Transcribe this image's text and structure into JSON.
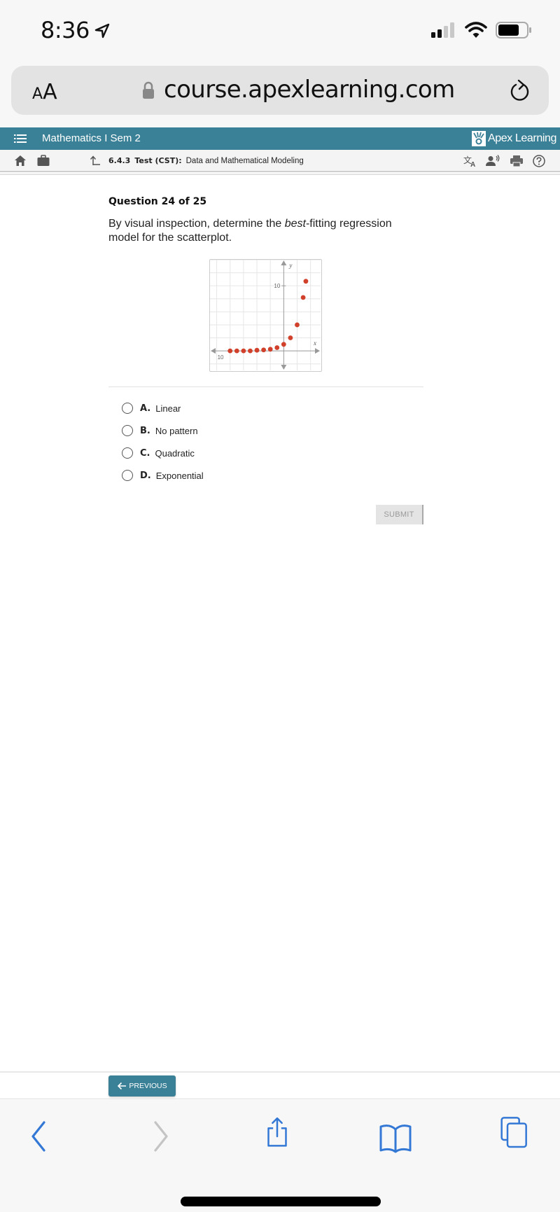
{
  "status_bar": {
    "time": "8:36",
    "icons": [
      "location-arrow-icon",
      "cellular-signal-icon",
      "wifi-icon",
      "battery-icon"
    ]
  },
  "browser": {
    "text_size_label_small": "A",
    "text_size_label_large": "A",
    "url": "course.apexlearning.com",
    "icons": [
      "lock-icon",
      "reload-icon"
    ]
  },
  "apex_header": {
    "course_title": "Mathematics I Sem 2",
    "brand": "Apex Learning",
    "brand_color": "#3a8197"
  },
  "lesson_bar": {
    "code": "6.4.3",
    "type": "Test (CST):",
    "title": "Data and Mathematical Modeling",
    "icons": [
      "home-icon",
      "briefcase-icon",
      "up-level-icon",
      "translate-icon",
      "text-to-speech-icon",
      "print-icon",
      "help-icon"
    ]
  },
  "question": {
    "number_label": "Question 24 of 25",
    "text_before": "By visual inspection, determine the ",
    "text_emphasis": "best",
    "text_after": "-fitting regression model for the scatterplot."
  },
  "chart_data": {
    "type": "scatter",
    "title": "",
    "xlabel": "x",
    "ylabel": "y",
    "tick_labels": {
      "x": [
        "10"
      ],
      "y": [
        "10"
      ]
    },
    "x_tick_label_value": -10,
    "y_tick_label_value": 10,
    "grid": true,
    "grid_step": 2,
    "xlim": [
      -11,
      5.5
    ],
    "ylim": [
      -3,
      14
    ],
    "point_color": "#d0402a",
    "points": [
      {
        "x": -8,
        "y": 0.0
      },
      {
        "x": -7,
        "y": 0.0
      },
      {
        "x": -6,
        "y": 0.0
      },
      {
        "x": -5,
        "y": 0.0
      },
      {
        "x": -4,
        "y": 0.1
      },
      {
        "x": -3,
        "y": 0.15
      },
      {
        "x": -2,
        "y": 0.25
      },
      {
        "x": -1,
        "y": 0.5
      },
      {
        "x": 0,
        "y": 1
      },
      {
        "x": 1,
        "y": 2
      },
      {
        "x": 2,
        "y": 4
      },
      {
        "x": 2.9,
        "y": 8.2
      },
      {
        "x": 3.3,
        "y": 10.7
      }
    ]
  },
  "options": [
    {
      "letter": "A.",
      "label": "Linear"
    },
    {
      "letter": "B.",
      "label": "No pattern"
    },
    {
      "letter": "C.",
      "label": "Quadratic"
    },
    {
      "letter": "D.",
      "label": "Exponential"
    }
  ],
  "submit_label": "SUBMIT",
  "previous_label": "PREVIOUS",
  "safari_toolbar": {
    "icons": [
      "back-icon",
      "forward-icon",
      "share-icon",
      "bookmarks-icon",
      "tabs-icon"
    ],
    "accent": "#3478d6"
  }
}
